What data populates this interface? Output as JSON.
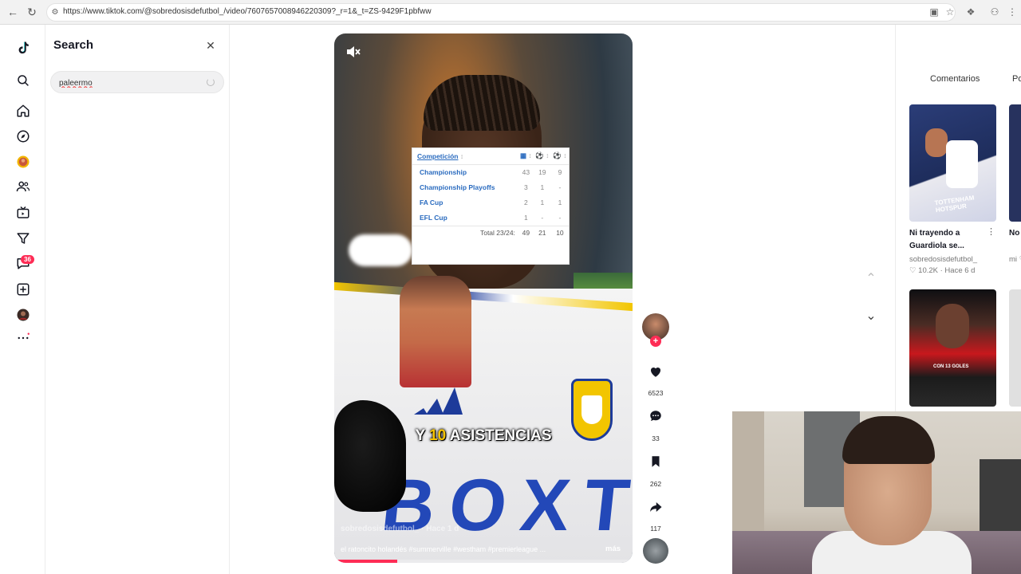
{
  "browser": {
    "url": "https://www.tiktok.com/@sobredosisdefutbol_/video/7607657008946220309?_r=1&_t=ZS-9429F1pbfww"
  },
  "rail": {
    "items": [
      "tiktok-logo",
      "search",
      "home",
      "explore",
      "live",
      "following",
      "tv",
      "upload-filter",
      "messages",
      "add",
      "profile",
      "more"
    ],
    "messages_badge": "36"
  },
  "search_panel": {
    "title": "Search",
    "query": "paleermo"
  },
  "video": {
    "caption_prefix": "Y ",
    "caption_highlight": "10",
    "caption_suffix": " ASISTENCIAS",
    "author": "sobredosisdefutbol_ · Hace 1 d",
    "description": "el ratoncito holandés #summerville #westham #premierleague ...",
    "more_label": "más",
    "progress": 0.21,
    "jersey_text": "BOXT",
    "stats_table": {
      "header": "Competición",
      "rows": [
        {
          "name": "Championship",
          "a": "43",
          "b": "19",
          "c": "9"
        },
        {
          "name": "Championship Playoffs",
          "a": "3",
          "b": "1",
          "c": "-"
        },
        {
          "name": "FA Cup",
          "a": "2",
          "b": "1",
          "c": "1"
        },
        {
          "name": "EFL Cup",
          "a": "1",
          "b": "-",
          "c": "-"
        }
      ],
      "total": {
        "label": "Total 23/24:",
        "a": "49",
        "b": "21",
        "c": "10"
      }
    }
  },
  "actions": {
    "likes": "6523",
    "comments": "33",
    "saves": "262",
    "shares": "117"
  },
  "right_panel": {
    "tab_comments": "Comentarios",
    "tab_other": "Po",
    "card1": {
      "title": "Ni trayendo a Guardiola se...",
      "author": "sobredosisdefutbol_",
      "meta": "♡ 10.2K · Hace 6 d",
      "thumb_text": "TOTTENHAM HOTSPUR"
    },
    "peek1": {
      "title": "No ge",
      "sub": "mi ♡"
    },
    "card2": {
      "thumb_text": "CON 13 GOLES"
    }
  },
  "colors": {
    "accent": "#fe2c55",
    "link_blue": "#2a6bbf",
    "caption_yellow": "#f6c400"
  }
}
